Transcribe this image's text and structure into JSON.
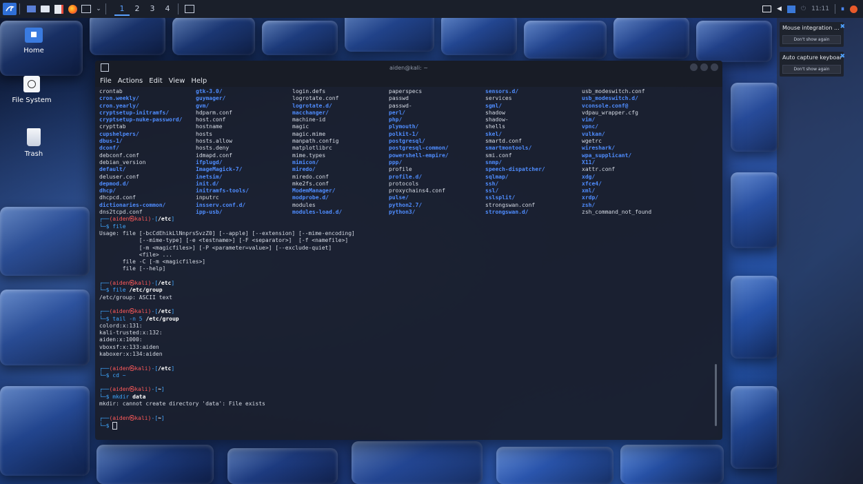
{
  "desktop": {
    "icons": [
      {
        "label": "Home"
      },
      {
        "label": "File System"
      },
      {
        "label": "Trash"
      }
    ]
  },
  "panel": {
    "workspaces": [
      "1",
      "2",
      "3",
      "4"
    ],
    "clock": "11:11"
  },
  "terminal": {
    "title": "aiden@kali: ~",
    "menu": [
      "File",
      "Actions",
      "Edit",
      "View",
      "Help"
    ],
    "ls_rows": [
      [
        [
          "crontab",
          0
        ],
        [
          "gtk-3.0/",
          1
        ],
        [
          "login.defs",
          0
        ],
        [
          "paperspecs",
          0
        ],
        [
          "sensors.d/",
          1
        ],
        [
          "usb_modeswitch.conf",
          0
        ]
      ],
      [
        [
          "cron.weekly/",
          1
        ],
        [
          "guymager/",
          1
        ],
        [
          "logrotate.conf",
          0
        ],
        [
          "passwd",
          0
        ],
        [
          "services",
          0
        ],
        [
          "usb_modeswitch.d/",
          1
        ]
      ],
      [
        [
          "cron.yearly/",
          1
        ],
        [
          "gvm/",
          1
        ],
        [
          "logrotate.d/",
          1
        ],
        [
          "passwd-",
          0
        ],
        [
          "sgml/",
          1
        ],
        [
          "vconsole.conf@",
          1
        ]
      ],
      [
        [
          "cryptsetup-initramfs/",
          1
        ],
        [
          "hdparm.conf",
          0
        ],
        [
          "macchanger/",
          1
        ],
        [
          "perl/",
          1
        ],
        [
          "shadow",
          0
        ],
        [
          "vdpau_wrapper.cfg",
          0
        ]
      ],
      [
        [
          "cryptsetup-nuke-password/",
          1
        ],
        [
          "host.conf",
          0
        ],
        [
          "machine-id",
          0
        ],
        [
          "php/",
          1
        ],
        [
          "shadow-",
          0
        ],
        [
          "vim/",
          1
        ]
      ],
      [
        [
          "crypttab",
          0
        ],
        [
          "hostname",
          0
        ],
        [
          "magic",
          0
        ],
        [
          "plymouth/",
          1
        ],
        [
          "shells",
          0
        ],
        [
          "vpnc/",
          1
        ]
      ],
      [
        [
          "cupshelpers/",
          1
        ],
        [
          "hosts",
          0
        ],
        [
          "magic.mime",
          0
        ],
        [
          "polkit-1/",
          1
        ],
        [
          "skel/",
          1
        ],
        [
          "vulkan/",
          1
        ]
      ],
      [
        [
          "dbus-1/",
          1
        ],
        [
          "hosts.allow",
          0
        ],
        [
          "manpath.config",
          0
        ],
        [
          "postgresql/",
          1
        ],
        [
          "smartd.conf",
          0
        ],
        [
          "wgetrc",
          0
        ]
      ],
      [
        [
          "dconf/",
          1
        ],
        [
          "hosts.deny",
          0
        ],
        [
          "matplotlibrc",
          0
        ],
        [
          "postgresql-common/",
          1
        ],
        [
          "smartmontools/",
          1
        ],
        [
          "wireshark/",
          1
        ]
      ],
      [
        [
          "debconf.conf",
          0
        ],
        [
          "idmapd.conf",
          0
        ],
        [
          "mime.types",
          0
        ],
        [
          "powershell-empire/",
          1
        ],
        [
          "smi.conf",
          0
        ],
        [
          "wpa_supplicant/",
          1
        ]
      ],
      [
        [
          "debian_version",
          0
        ],
        [
          "ifplugd/",
          1
        ],
        [
          "mimicon/",
          1
        ],
        [
          "ppp/",
          1
        ],
        [
          "snmp/",
          1
        ],
        [
          "X11/",
          1
        ]
      ],
      [
        [
          "default/",
          1
        ],
        [
          "ImageMagick-7/",
          1
        ],
        [
          "miredo/",
          1
        ],
        [
          "profile",
          0
        ],
        [
          "speech-dispatcher/",
          1
        ],
        [
          "xattr.conf",
          0
        ]
      ],
      [
        [
          "deluser.conf",
          0
        ],
        [
          "inetsim/",
          1
        ],
        [
          "miredo.conf",
          0
        ],
        [
          "profile.d/",
          1
        ],
        [
          "sqlmap/",
          1
        ],
        [
          "xdg/",
          1
        ]
      ],
      [
        [
          "depmod.d/",
          1
        ],
        [
          "init.d/",
          1
        ],
        [
          "mke2fs.conf",
          0
        ],
        [
          "protocols",
          0
        ],
        [
          "ssh/",
          1
        ],
        [
          "xfce4/",
          1
        ]
      ],
      [
        [
          "dhcp/",
          1
        ],
        [
          "initramfs-tools/",
          1
        ],
        [
          "ModemManager/",
          1
        ],
        [
          "proxychains4.conf",
          0
        ],
        [
          "ssl/",
          1
        ],
        [
          "xml/",
          1
        ]
      ],
      [
        [
          "dhcpcd.conf",
          0
        ],
        [
          "inputrc",
          0
        ],
        [
          "modprobe.d/",
          1
        ],
        [
          "pulse/",
          1
        ],
        [
          "sslsplit/",
          1
        ],
        [
          "xrdp/",
          1
        ]
      ],
      [
        [
          "dictionaries-common/",
          1
        ],
        [
          "insserv.conf.d/",
          1
        ],
        [
          "modules",
          0
        ],
        [
          "python2.7/",
          1
        ],
        [
          "strongswan.conf",
          0
        ],
        [
          "zsh/",
          1
        ]
      ],
      [
        [
          "dns2tcpd.conf",
          0
        ],
        [
          "ipp-usb/",
          1
        ],
        [
          "modules-load.d/",
          1
        ],
        [
          "python3/",
          1
        ],
        [
          "strongswan.d/",
          1
        ],
        [
          "zsh_command_not_found",
          0
        ]
      ]
    ],
    "prompt_user": "(aiden㉿kali)",
    "session": [
      {
        "type": "prompt",
        "dir": "/etc",
        "cmd": "file",
        "arg": ""
      },
      {
        "type": "out",
        "text": "Usage: file [-bcCdEhikLlNnprsSvzZ0] [--apple] [--extension] [--mime-encoding]"
      },
      {
        "type": "out",
        "text": "            [--mime-type] [-e <testname>] [-F <separator>]  [-f <namefile>]"
      },
      {
        "type": "out",
        "text": "            [-m <magicfiles>] [-P <parameter=value>] [--exclude-quiet]"
      },
      {
        "type": "out",
        "text": "            <file> ..."
      },
      {
        "type": "out",
        "text": "       file -C [-m <magicfiles>]"
      },
      {
        "type": "out",
        "text": "       file [--help]"
      },
      {
        "type": "gap"
      },
      {
        "type": "prompt",
        "dir": "/etc",
        "cmd": "file",
        "arg": "/etc/group"
      },
      {
        "type": "out",
        "text": "/etc/group: ASCII text"
      },
      {
        "type": "gap"
      },
      {
        "type": "prompt",
        "dir": "/etc",
        "cmd": "tail -n 5",
        "arg": "/etc/group"
      },
      {
        "type": "out",
        "text": "colord:x:131:"
      },
      {
        "type": "out",
        "text": "kali-trusted:x:132:"
      },
      {
        "type": "out",
        "text": "aiden:x:1000:"
      },
      {
        "type": "out",
        "text": "vboxsf:x:133:aiden"
      },
      {
        "type": "out",
        "text": "kaboxer:x:134:aiden"
      },
      {
        "type": "gap"
      },
      {
        "type": "prompt",
        "dir": "/etc",
        "cmd": "cd ~",
        "arg": ""
      },
      {
        "type": "gap"
      },
      {
        "type": "prompt",
        "dir": "~",
        "cmd": "mkdir",
        "arg": "data"
      },
      {
        "type": "out",
        "text": "mkdir: cannot create directory 'data': File exists"
      },
      {
        "type": "gap"
      },
      {
        "type": "prompt",
        "dir": "~",
        "cmd": "",
        "arg": "",
        "cursor": true
      }
    ]
  },
  "notifications": [
    {
      "title": "Mouse integration ...",
      "button": "Don't show again"
    },
    {
      "title": "Auto capture keyboard ...",
      "button": "Don't show again"
    }
  ],
  "colors": {
    "dir": "#4f8dff",
    "prompt": "#3fa7ff",
    "user_at_host": "#ff5a5a",
    "panel": "#1a1f2a"
  }
}
